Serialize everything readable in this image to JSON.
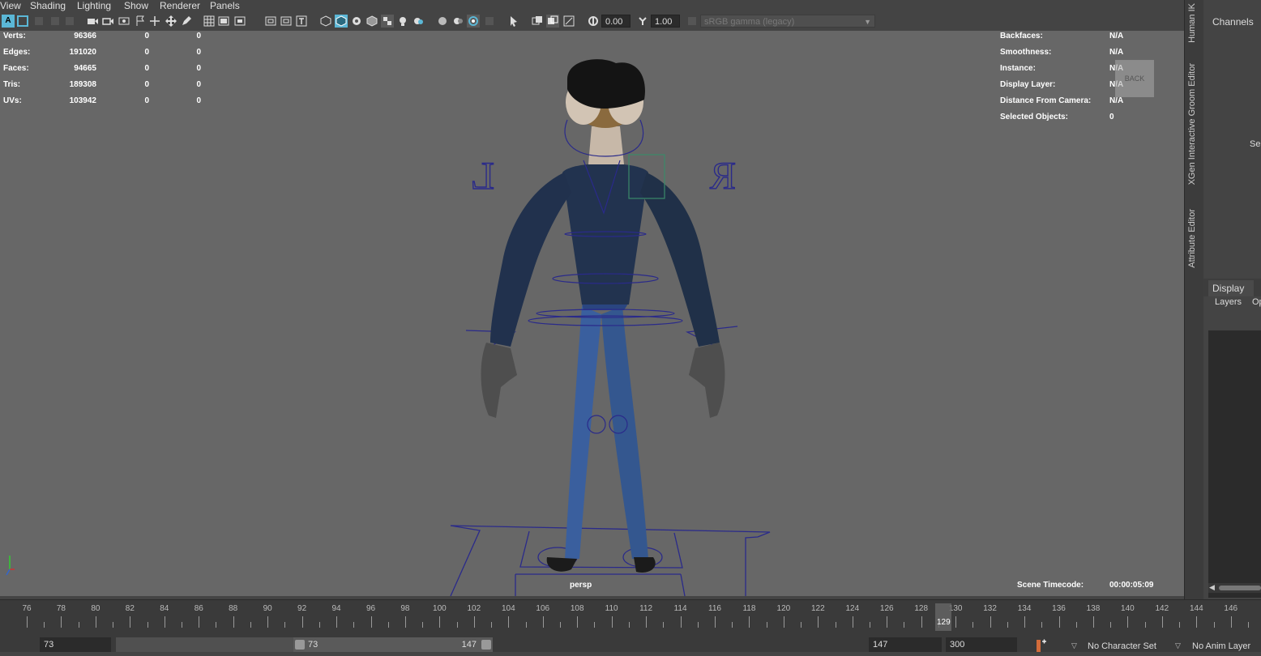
{
  "menu": [
    "View",
    "Shading",
    "Lighting",
    "Show",
    "Renderer",
    "Panels"
  ],
  "toolbar": {
    "exposure": "0.00",
    "gamma": "1.00",
    "color_space": "sRGB gamma (legacy)"
  },
  "hud_left": [
    {
      "label": "Verts:",
      "v1": "96366",
      "v2": "0",
      "v3": "0"
    },
    {
      "label": "Edges:",
      "v1": "191020",
      "v2": "0",
      "v3": "0"
    },
    {
      "label": "Faces:",
      "v1": "94665",
      "v2": "0",
      "v3": "0"
    },
    {
      "label": "Tris:",
      "v1": "189308",
      "v2": "0",
      "v3": "0"
    },
    {
      "label": "UVs:",
      "v1": "103942",
      "v2": "0",
      "v3": "0"
    }
  ],
  "hud_right": [
    {
      "label": "Backfaces:",
      "value": "N/A"
    },
    {
      "label": "Smoothness:",
      "value": "N/A"
    },
    {
      "label": "Instance:",
      "value": "N/A"
    },
    {
      "label": "Display Layer:",
      "value": "N/A"
    },
    {
      "label": "Distance From Camera:",
      "value": "N/A"
    },
    {
      "label": "Selected Objects:",
      "value": "0"
    }
  ],
  "view_cube": "BACK",
  "viewport": {
    "camera": "persp",
    "timecode_label": "Scene Timecode:",
    "timecode": "00:00:05:09",
    "rig_letters": [
      "L",
      "R"
    ]
  },
  "side_tabs": [
    "Human IK",
    "XGen Interactive Groom Editor",
    "Attribute Editor"
  ],
  "channel_box": {
    "title": "Channels",
    "cut_text": "Sel",
    "layer_tab": "Display",
    "layer_menu_1": "Layers",
    "layer_menu_2": "Op"
  },
  "timeline": {
    "ticks": [
      "76",
      "78",
      "80",
      "82",
      "84",
      "86",
      "88",
      "90",
      "92",
      "94",
      "96",
      "98",
      "100",
      "102",
      "104",
      "106",
      "108",
      "110",
      "112",
      "114",
      "116",
      "118",
      "120",
      "122",
      "124",
      "126",
      "128",
      "130",
      "132",
      "134",
      "136",
      "138",
      "140",
      "142",
      "144",
      "146"
    ],
    "current": "129"
  },
  "range": {
    "start": "73",
    "range_start": "73",
    "range_end": "147",
    "end": "147",
    "max": "300",
    "character_set": "No Character Set",
    "anim_layer": "No Anim Layer"
  },
  "colors": {
    "viewport": "#676767",
    "rig": "#2a2a8a",
    "shirt": "#22334f",
    "pants": "#3a5f9e",
    "skin": "#c7b8a8",
    "hands": "#4e4e4e",
    "hair": "#141414",
    "highlight": "#5bb7d6"
  }
}
